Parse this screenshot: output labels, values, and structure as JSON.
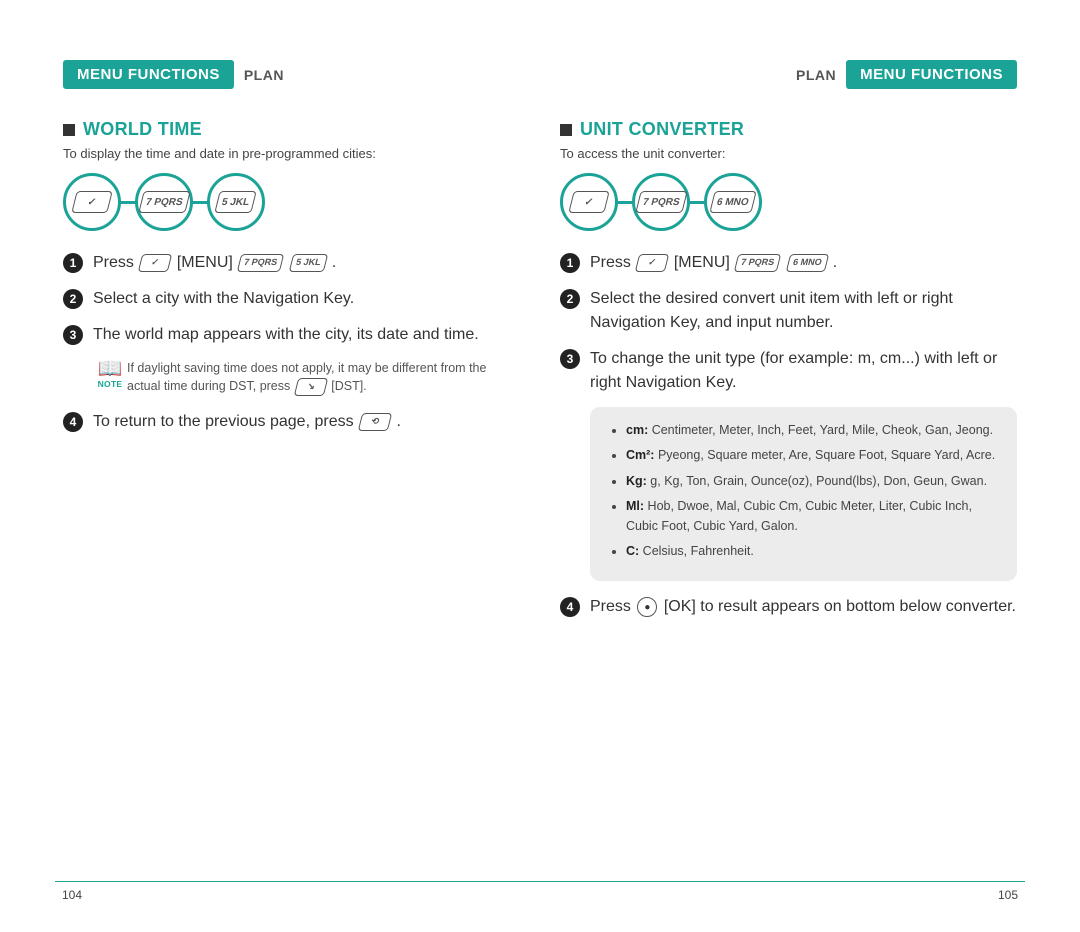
{
  "header": {
    "badge": "MENU FUNCTIONS",
    "crumb": "PLAN"
  },
  "left": {
    "title": "WORLD TIME",
    "intro": "To display the time and date in pre-programmed cities:",
    "keys": {
      "soft": "✓",
      "k7": "7 PQRS",
      "k5": "5 JKL"
    },
    "steps": {
      "s1_a": "Press",
      "s1_b": "[MENU]",
      "s1_c": ".",
      "s2": "Select a city with the Navigation Key.",
      "s3": "The world map appears with the city, its date and time.",
      "s4_a": "To return to the previous page, press",
      "s4_b": "."
    },
    "note": {
      "label": "NOTE",
      "text_a": "If daylight saving time does not apply, it may be different from the actual time during DST, press",
      "text_b": "[DST].",
      "key": "↘"
    }
  },
  "right": {
    "title": "UNIT CONVERTER",
    "intro": "To access the unit converter:",
    "keys": {
      "soft": "✓",
      "k7": "7 PQRS",
      "k6": "6 MNO"
    },
    "steps": {
      "s1_a": "Press",
      "s1_b": "[MENU]",
      "s1_c": ".",
      "s2": "Select the desired convert unit item with left or right Navigation Key, and input number.",
      "s3": "To change the unit type (for example: m, cm...) with left or right Navigation Key.",
      "s4_a": "Press",
      "s4_b": "[OK] to result appears on bottom below converter.",
      "ok": "●"
    },
    "units": {
      "u1_l": "cm:",
      "u1_t": " Centimeter, Meter, Inch, Feet, Yard, Mile, Cheok, Gan, Jeong.",
      "u2_l": "Cm²:",
      "u2_t": " Pyeong, Square meter, Are, Square Foot, Square Yard, Acre.",
      "u3_l": "Kg:",
      "u3_t": " g, Kg, Ton, Grain, Ounce(oz), Pound(lbs), Don, Geun, Gwan.",
      "u4_l": "Ml:",
      "u4_t": " Hob, Dwoe, Mal, Cubic Cm, Cubic Meter, Liter, Cubic Inch, Cubic Foot, Cubic Yard, Galon.",
      "u5_l": "C:",
      "u5_t": " Celsius, Fahrenheit."
    }
  },
  "pages": {
    "left": "104",
    "right": "105"
  }
}
